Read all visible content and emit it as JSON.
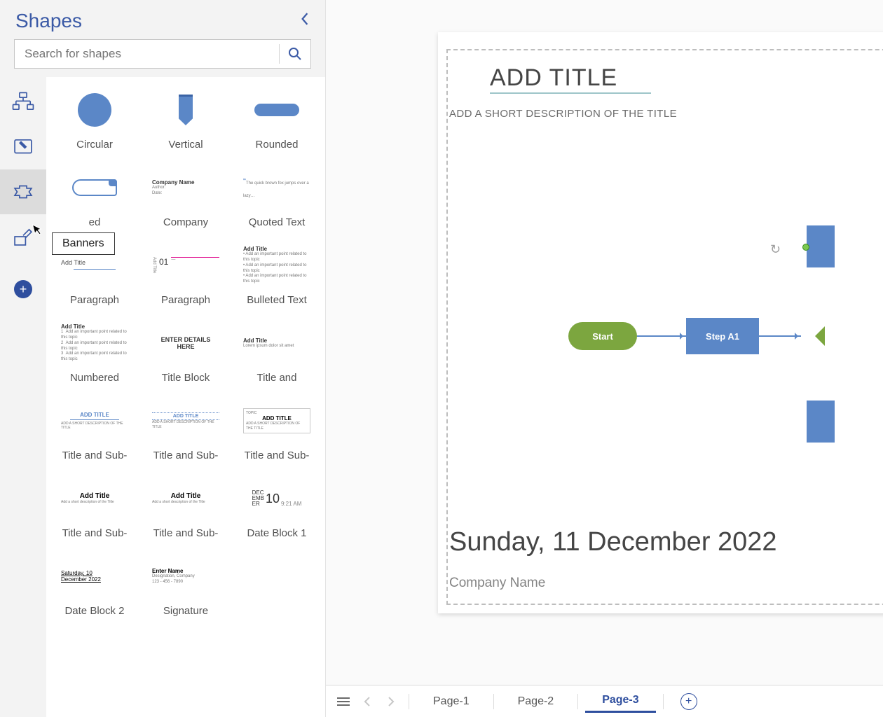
{
  "panel": {
    "title": "Shapes",
    "search_placeholder": "Search for shapes",
    "tooltip": "Banners",
    "categories": [
      {
        "id": "flowchart",
        "selected": false
      },
      {
        "id": "containers",
        "selected": false
      },
      {
        "id": "banners",
        "selected": true
      },
      {
        "id": "annotate",
        "selected": false
      }
    ],
    "shapes": [
      {
        "label": "Circular"
      },
      {
        "label": "Vertical"
      },
      {
        "label": "Rounded"
      },
      {
        "label": "ed"
      },
      {
        "label": "Company"
      },
      {
        "label": "Quoted Text"
      },
      {
        "label": "Paragraph"
      },
      {
        "label": "Paragraph"
      },
      {
        "label": "Bulleted Text"
      },
      {
        "label": "Numbered"
      },
      {
        "label": "Title Block"
      },
      {
        "label": "Title and"
      },
      {
        "label": "Title and Sub-"
      },
      {
        "label": "Title and Sub-"
      },
      {
        "label": "Title and Sub-"
      },
      {
        "label": "Title and Sub-"
      },
      {
        "label": "Title and Sub-"
      },
      {
        "label": "Date Block 1"
      },
      {
        "label": "Date Block 2"
      },
      {
        "label": "Signature"
      }
    ]
  },
  "canvas": {
    "title": "ADD TITLE",
    "subtitle": "ADD A SHORT DESCRIPTION OF THE TITLE",
    "flow": {
      "start": "Start",
      "step": "Step A1"
    },
    "date": "Sunday, 11 December 2022",
    "company": "Company Name"
  },
  "tabs": {
    "items": [
      "Page-1",
      "Page-2",
      "Page-3"
    ],
    "active": 2
  },
  "thumb_text": {
    "company_name": "Company Name",
    "author": "Author:",
    "date": "Date:",
    "add_title": "Add Title",
    "add_title_caps": "ADD TITLE",
    "num01": "01",
    "enter_details": "ENTER DETAILS HERE",
    "dec": "DEC",
    "emb": "EMB",
    "er": "ER",
    "ten": "10",
    "time": "9:21 AM",
    "sat": "Saturday, 10",
    "sat2": "December 2022",
    "enter_name": "Enter Name",
    "desig": "Designation, Company",
    "phone": "123 - 456 - 7890",
    "tiny_sub": "Add a short description of the Title",
    "tiny_sub_caps": "ADD A SHORT DESCRIPTION OF THE TITLE"
  }
}
